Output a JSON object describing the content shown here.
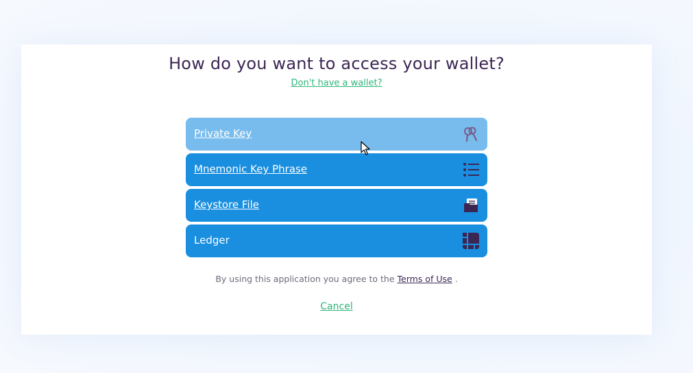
{
  "dialog": {
    "title": "How do you want to access your wallet?",
    "no_wallet_link": "Don't have a wallet?",
    "options": [
      {
        "label": "Private Key",
        "icon": "keys-icon",
        "state": "hover"
      },
      {
        "label": "Mnemonic Key Phrase",
        "icon": "list-icon",
        "state": "default"
      },
      {
        "label": "Keystore File",
        "icon": "folder-icon",
        "state": "default"
      },
      {
        "label": "Ledger",
        "icon": "ledger-icon",
        "state": "default"
      }
    ],
    "terms_prefix": "By using this application you agree to the",
    "terms_link": "Terms of Use",
    "terms_suffix": ".",
    "cancel": "Cancel"
  },
  "colors": {
    "option_bg": "#1a8fe0",
    "option_hover_bg": "#78bcee",
    "title": "#3b2653",
    "link_green": "#2fb47a",
    "icon": "#3b2653"
  }
}
